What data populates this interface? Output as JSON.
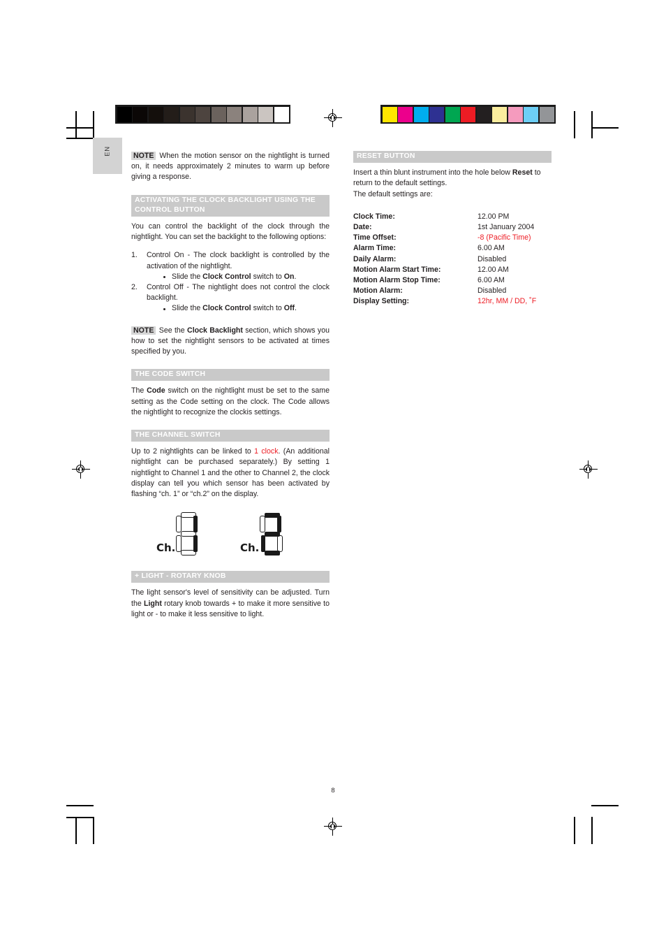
{
  "page": {
    "language_tab": "EN",
    "page_number": "8"
  },
  "prepress": {
    "grayscale_bar": [
      "#000000",
      "#0b0706",
      "#140f0c",
      "#231d19",
      "#3b332e",
      "#4d443f",
      "#6b625d",
      "#8b827d",
      "#aaa29e",
      "#cbc5c1",
      "#ffffff"
    ],
    "color_bar": [
      "#ffe600",
      "#ec008c",
      "#00aeef",
      "#2e3192",
      "#00a651",
      "#ed1c24",
      "#231f20",
      "#faed9e",
      "#f59bbe",
      "#6dcff6",
      "#939598"
    ]
  },
  "left_column": {
    "note_1": {
      "tag": "NOTE",
      "text": "When the motion sensor on the nightlight is turned on, it needs approximately 2 minutes to warm up before giving a response."
    },
    "section_backlight": {
      "heading": "ACTIVATING THE CLOCK BACKLIGHT USING THE CONTROL BUTTON",
      "intro": "You can control the backlight of the clock through the nightlight. You can set the backlight to the following options:",
      "items": [
        {
          "num": "1.",
          "text": "Control On - The clock backlight is controlled by the activation of the nightlight.",
          "bullet_prefix": "Slide the ",
          "bullet_bold": "Clock Control",
          "bullet_mid": " switch to ",
          "bullet_bold2": "On",
          "bullet_suffix": "."
        },
        {
          "num": "2.",
          "text": "Control Off - The nightlight does not control the clock backlight.",
          "bullet_prefix": "Slide the ",
          "bullet_bold": "Clock Control",
          "bullet_mid": " switch to ",
          "bullet_bold2": "Off",
          "bullet_suffix": "."
        }
      ]
    },
    "note_2": {
      "tag": "NOTE",
      "text_before": "See the ",
      "text_bold": "Clock Backlight",
      "text_after": " section, which shows you how to set the nightlight sensors to be activated at times specified by you."
    },
    "section_code": {
      "heading": "THE CODE SWITCH",
      "text_before": "The ",
      "text_bold": "Code",
      "text_after": " switch on the nightlight must be set to the same setting as the Code setting on the clock. The Code allows the nightlight to recognize the clockis settings."
    },
    "section_channel": {
      "heading": "THE CHANNEL SWITCH",
      "text_before": "Up to 2 nightlights can be linked to ",
      "text_red": "1 clock",
      "text_after": ". (An additional nightlight can be purchased separately.) By setting 1 nightlight to Channel 1 and the other to Channel 2, the clock display can tell you which sensor has been activated by flashing “ch. 1” or “ch.2” on the display.",
      "figures": [
        {
          "label": "Ch.",
          "digit": "1"
        },
        {
          "label": "Ch.",
          "digit": "2"
        }
      ]
    },
    "section_light": {
      "heading": "+ LIGHT - ROTARY KNOB",
      "text_before": "The light sensor's level of sensitivity can be adjusted. Turn the ",
      "text_bold": "Light",
      "text_after": " rotary knob towards + to make it more sensitive to light or - to make it less sensitive to light."
    }
  },
  "right_column": {
    "section_reset": {
      "heading": "RESET BUTTON",
      "text_before": "Insert a thin blunt instrument into the hole below ",
      "text_bold": "Reset",
      "text_after": " to return to the default settings.",
      "text_line2": "The default settings are:"
    },
    "defaults_table": {
      "rows": [
        {
          "key": "Clock Time:",
          "value": "12.00 PM",
          "color": "#231f20"
        },
        {
          "key": "Date:",
          "value": "1st January 2004",
          "color": "#231f20"
        },
        {
          "key": "Time Offset:",
          "value": "-8 (Pacific Time)",
          "color": "#ed1c24"
        },
        {
          "key": "Alarm Time:",
          "value": "6.00 AM",
          "color": "#231f20"
        },
        {
          "key": "Daily Alarm:",
          "value": "Disabled",
          "color": "#231f20"
        },
        {
          "key": "Motion Alarm Start Time:",
          "value": "12.00 AM",
          "color": "#231f20"
        },
        {
          "key": "Motion Alarm Stop Time:",
          "value": "6.00 AM",
          "color": "#231f20"
        },
        {
          "key": "Motion Alarm:",
          "value": "Disabled",
          "color": "#231f20"
        },
        {
          "key": "Display Setting:",
          "value": "12hr, MM / DD, ˚F",
          "color": "#ed1c24"
        }
      ]
    }
  }
}
